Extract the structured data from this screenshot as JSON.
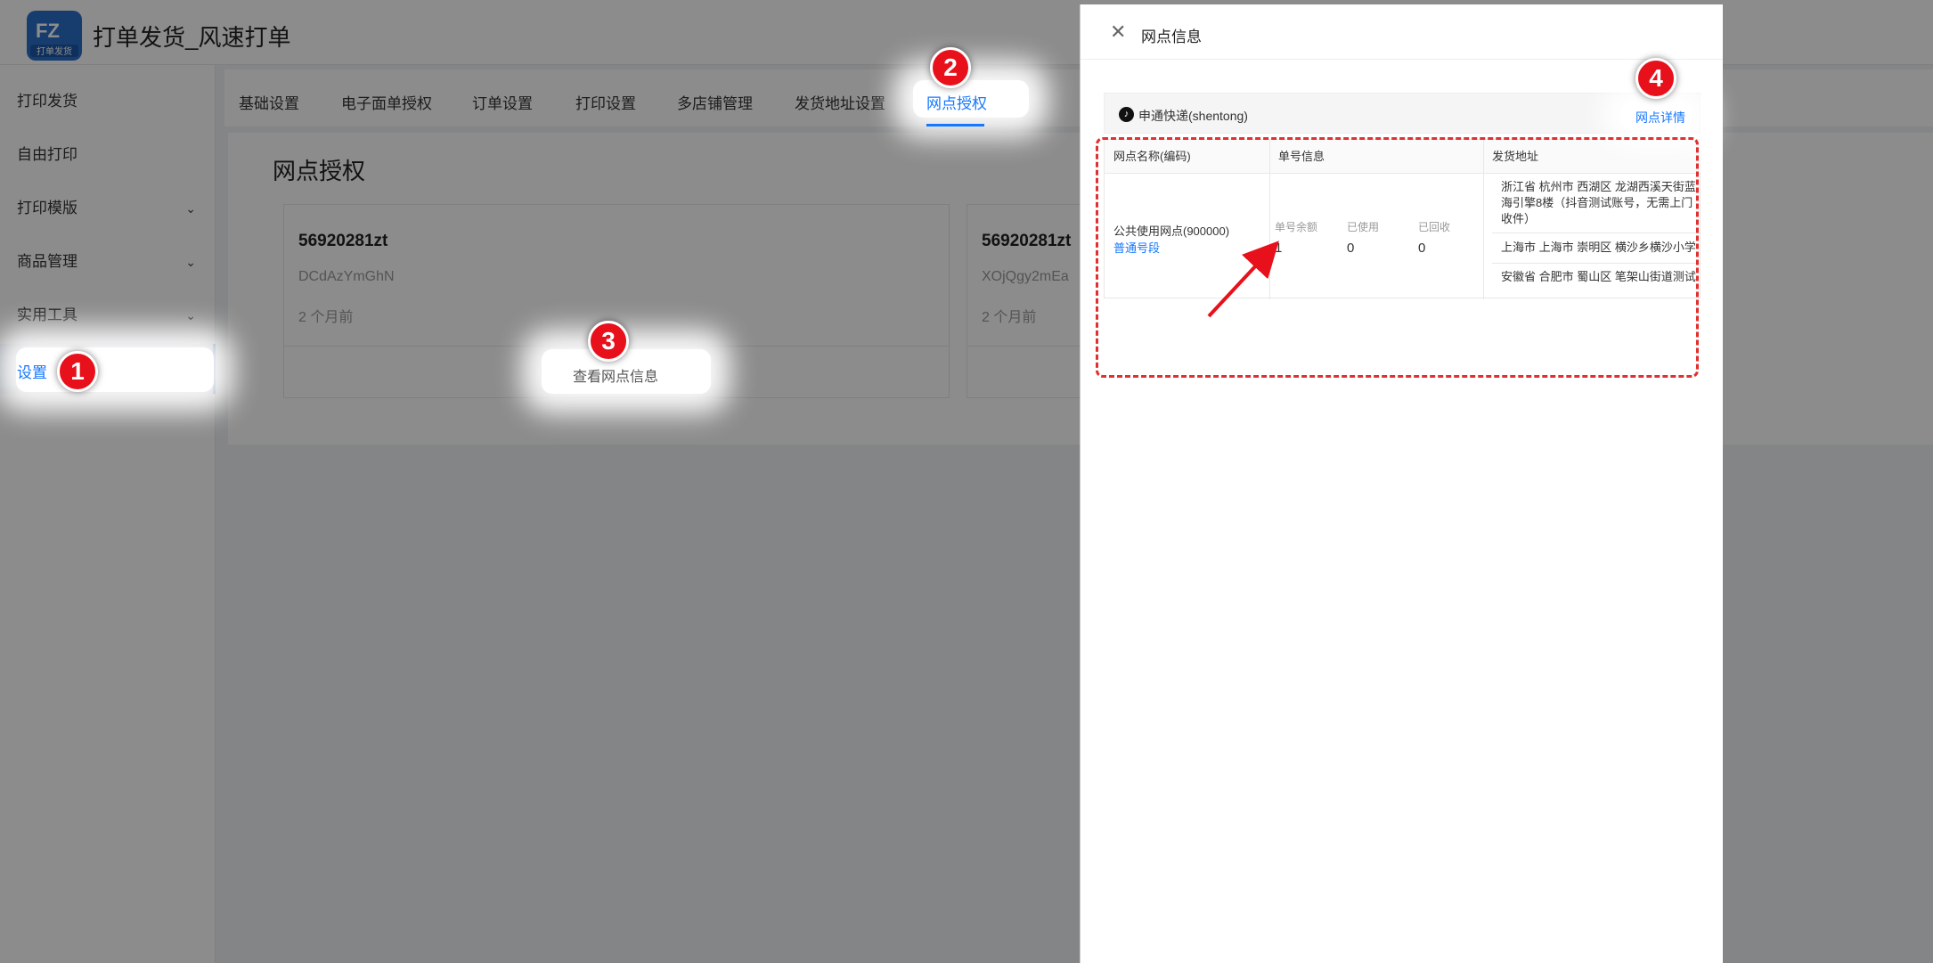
{
  "app": {
    "title": "打单发货_风速打单",
    "logo_text": "打单发货"
  },
  "sidebar": {
    "items": [
      {
        "label": "打印发货"
      },
      {
        "label": "自由打印"
      },
      {
        "label": "打印模版"
      },
      {
        "label": "商品管理"
      },
      {
        "label": "实用工具"
      },
      {
        "label": "设置"
      }
    ]
  },
  "tabs": [
    "基础设置",
    "电子面单授权",
    "订单设置",
    "打印设置",
    "多店铺管理",
    "发货地址设置",
    "网点授权"
  ],
  "page_title": "网点授权",
  "cards": [
    {
      "code": "56920281zt",
      "sub": "DCdAzYmGhN",
      "time": "2 个月前",
      "action": "查看网点信息"
    },
    {
      "code": "56920281zt",
      "sub": "XOjQgy2mEa",
      "time": "2 个月前"
    }
  ],
  "drawer": {
    "title": "网点信息",
    "express": "申通快递(shentong)",
    "detail_link": "网点详情",
    "table": {
      "headers": [
        "网点名称(编码)",
        "单号信息",
        "发货地址"
      ],
      "site_name": "公共使用网点(900000)",
      "site_type": "普通号段",
      "stats": [
        {
          "label": "单号余额",
          "value": "1"
        },
        {
          "label": "已使用",
          "value": "0"
        },
        {
          "label": "已回收",
          "value": "0"
        }
      ],
      "addresses": [
        "浙江省 杭州市 西湖区 龙湖西溪天街蓝海引擎8楼（抖音测试账号，无需上门收件）",
        "上海市 上海市 崇明区 横沙乡横沙小学",
        "安徽省 合肥市 蜀山区 笔架山街道测试"
      ]
    }
  },
  "callouts": [
    "1",
    "2",
    "3",
    "4"
  ],
  "colors": {
    "accent": "#1677ff",
    "badge": "#e8101a"
  }
}
